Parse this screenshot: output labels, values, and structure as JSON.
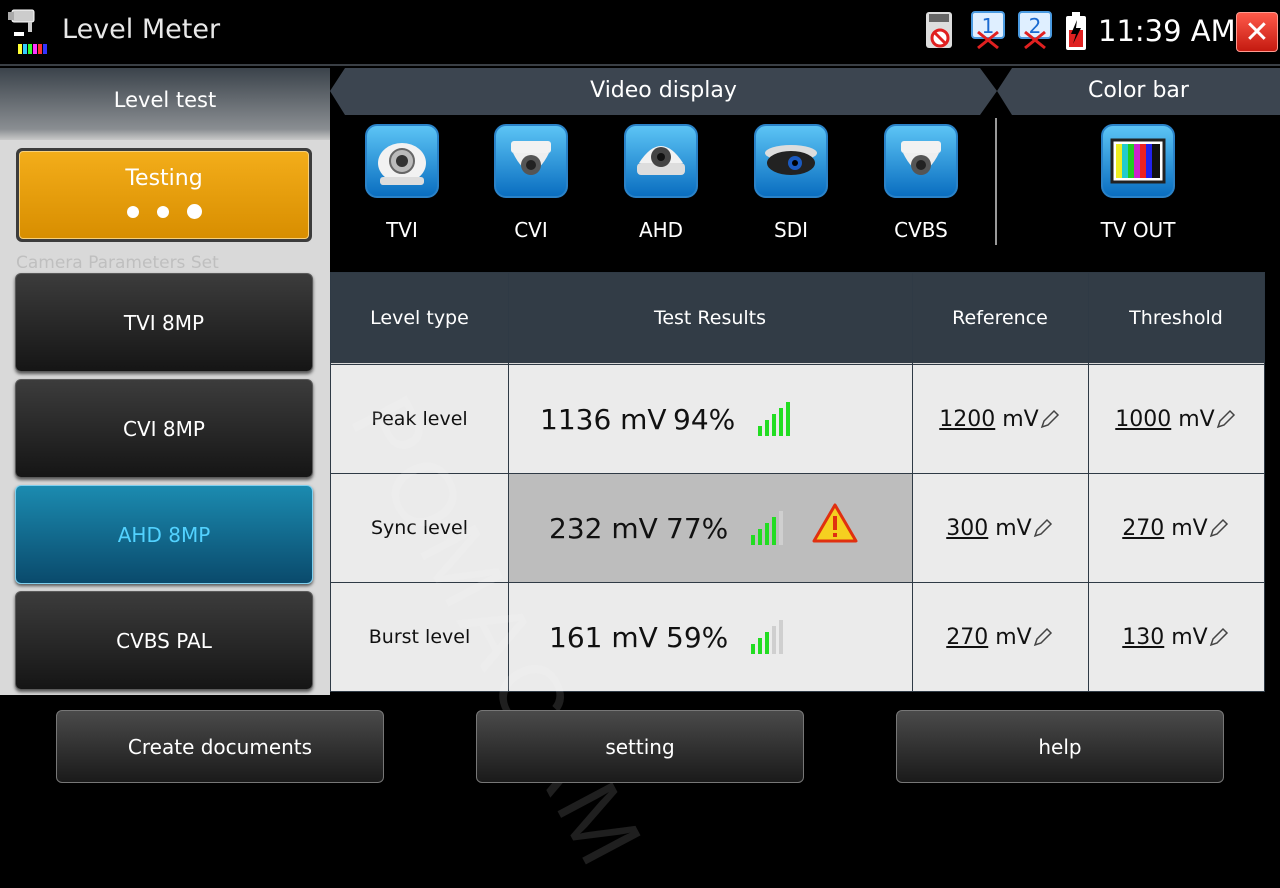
{
  "app": {
    "title": "Level Meter",
    "clock": "11:39 AM",
    "close_symbol": "✕"
  },
  "status_icons": [
    "sd-card-blocked-icon",
    "channel-1-off-icon",
    "channel-2-off-icon",
    "battery-charging-icon"
  ],
  "left": {
    "header": "Level test",
    "testing_label": "Testing",
    "camera_params_label": "Camera Parameters Set",
    "modes": [
      {
        "label": "TVI 8MP",
        "active": false
      },
      {
        "label": "CVI 8MP",
        "active": false
      },
      {
        "label": "AHD 8MP",
        "active": true
      },
      {
        "label": "CVBS PAL",
        "active": false
      }
    ]
  },
  "video_display": {
    "header": "Video display",
    "items": [
      {
        "label": "TVI",
        "icon": "cctv-camera-icon"
      },
      {
        "label": "CVI",
        "icon": "dome-camera-icon"
      },
      {
        "label": "AHD",
        "icon": "dome-camera-icon"
      },
      {
        "label": "SDI",
        "icon": "sdi-camera-icon"
      },
      {
        "label": "CVBS",
        "icon": "dome-camera-icon"
      }
    ]
  },
  "color_bar": {
    "header": "Color bar",
    "item_label": "TV OUT",
    "icon": "color-bars-icon"
  },
  "table": {
    "headers": [
      "Level type",
      "Test Results",
      "Reference",
      "Threshold"
    ],
    "rows": [
      {
        "type": "Peak level",
        "value": "1136 mV",
        "percent": "94%",
        "signal_bars": 5,
        "warning": false,
        "reference": "1200",
        "threshold": "1000",
        "unit": "mV"
      },
      {
        "type": "Sync level",
        "value": "232 mV",
        "percent": "77%",
        "signal_bars": 4,
        "warning": true,
        "reference": "300",
        "threshold": "270",
        "unit": "mV"
      },
      {
        "type": "Burst level",
        "value": "161 mV",
        "percent": "59%",
        "signal_bars": 3,
        "warning": false,
        "reference": "270",
        "threshold": "130",
        "unit": "mV"
      }
    ]
  },
  "bottom": {
    "create_documents": "Create documents",
    "setting": "setting",
    "help": "help"
  },
  "watermark": "POMACAM",
  "colors": {
    "accent": "#f3ad1a",
    "active_mode": "#0a4a6c",
    "signal_green": "#22dd22",
    "warning_red": "#e03010"
  }
}
